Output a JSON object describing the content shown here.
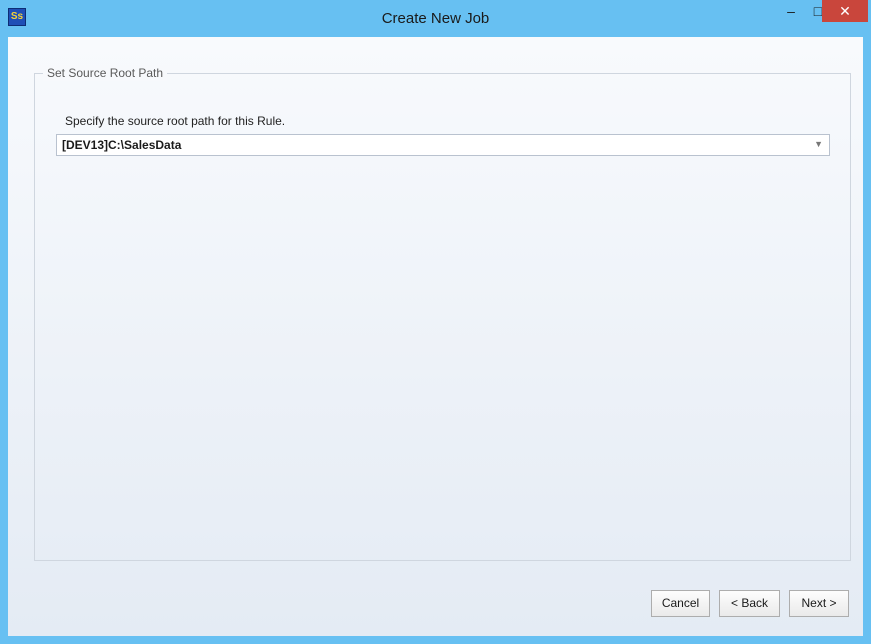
{
  "window": {
    "title": "Create New Job",
    "app_icon_text": "Ss",
    "minimize_glyph": "–",
    "maximize_glyph": "□",
    "close_glyph": "✕"
  },
  "group": {
    "legend": "Set Source Root Path",
    "instruction": "Specify the source root path for this Rule.",
    "source_path_value": "[DEV13]C:\\SalesData",
    "dropdown_glyph": "▼"
  },
  "buttons": {
    "cancel": "Cancel",
    "back": "< Back",
    "next": "Next >"
  }
}
